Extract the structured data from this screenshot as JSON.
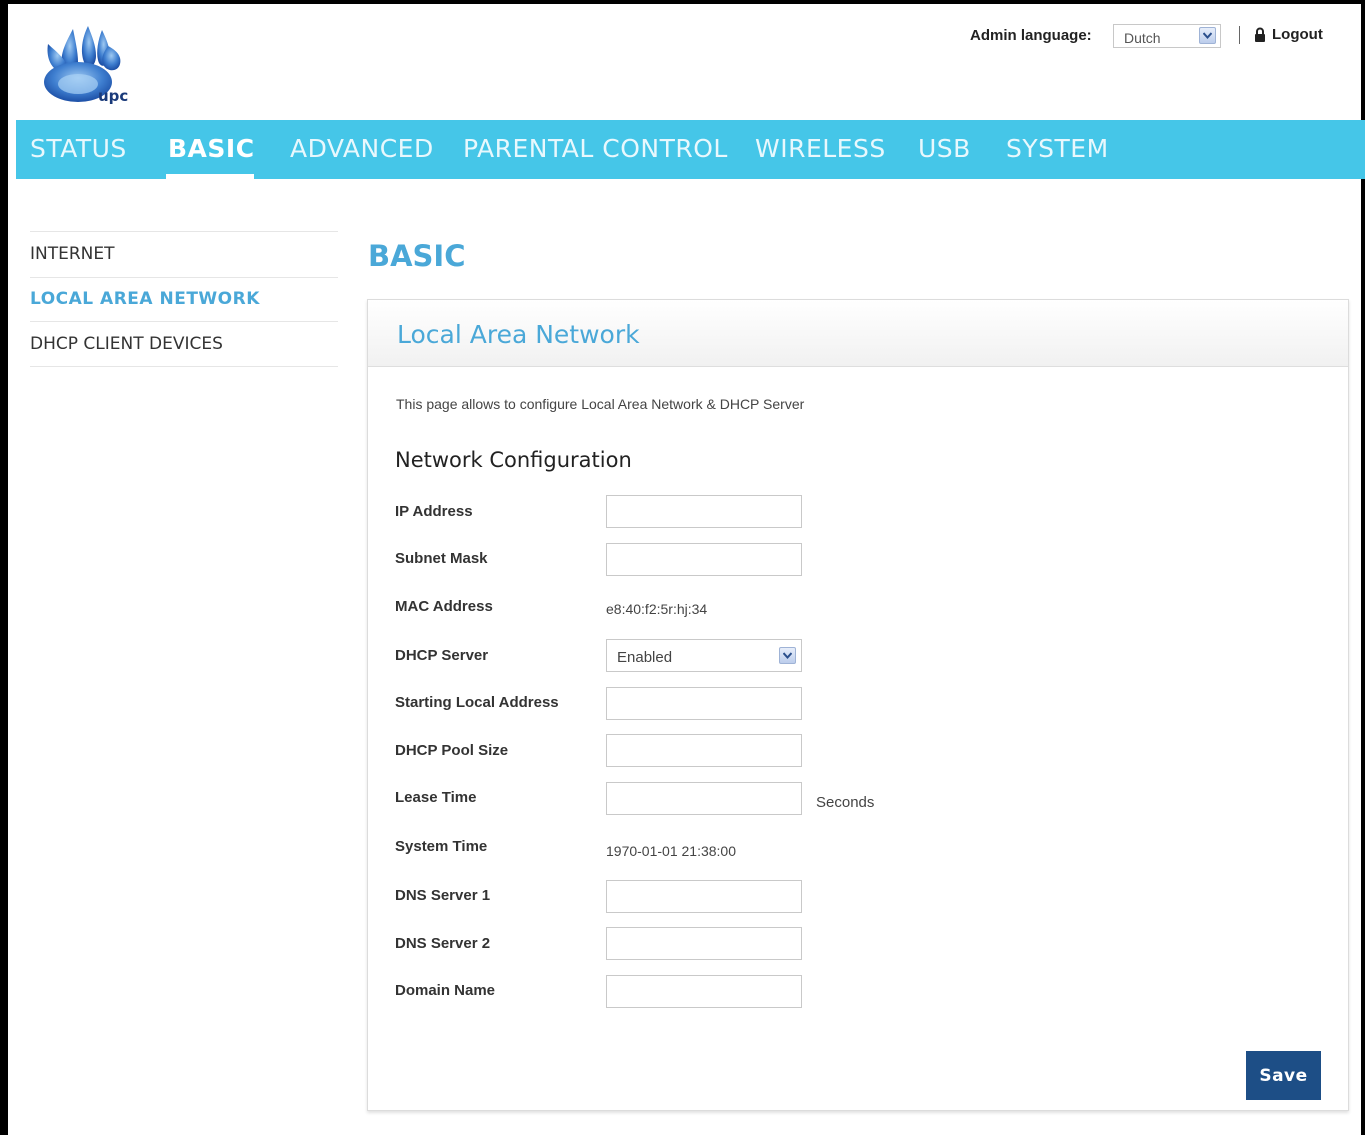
{
  "header": {
    "logo_text": "upc",
    "admin_language_label": "Admin language:",
    "admin_language_value": "Dutch",
    "logout_label": "Logout"
  },
  "nav": {
    "items": [
      "STATUS",
      "BASIC",
      "ADVANCED",
      "PARENTAL CONTROL",
      "WIRELESS",
      "USB",
      "SYSTEM"
    ],
    "active": "BASIC"
  },
  "sidebar": {
    "items": [
      "INTERNET",
      "LOCAL AREA NETWORK",
      "DHCP CLIENT DEVICES"
    ],
    "active": "LOCAL AREA NETWORK"
  },
  "main": {
    "page_title": "BASIC",
    "panel_title": "Local Area Network",
    "description": "This page allows to configure Local Area Network & DHCP Server",
    "section_title": "Network Configuration",
    "fields": {
      "ip_address": {
        "label": "IP Address",
        "value": ""
      },
      "subnet_mask": {
        "label": "Subnet Mask",
        "value": ""
      },
      "mac_address": {
        "label": "MAC Address",
        "value": "e8:40:f2:5r:hj:34"
      },
      "dhcp_server": {
        "label": "DHCP Server",
        "value": "Enabled"
      },
      "starting_local_address": {
        "label": "Starting Local Address",
        "value": ""
      },
      "dhcp_pool_size": {
        "label": "DHCP Pool Size",
        "value": ""
      },
      "lease_time": {
        "label": "Lease Time",
        "value": "",
        "unit": "Seconds"
      },
      "system_time": {
        "label": "System Time",
        "value": "1970-01-01 21:38:00"
      },
      "dns_server_1": {
        "label": "DNS Server 1",
        "value": ""
      },
      "dns_server_2": {
        "label": "DNS Server 2",
        "value": ""
      },
      "domain_name": {
        "label": "Domain Name",
        "value": ""
      }
    },
    "save_label": "Save"
  },
  "colors": {
    "nav_bg": "#45c6e8",
    "accent": "#4aa8d8",
    "save_bg": "#1d4e86"
  },
  "icons": [
    "upc-logo-icon",
    "chevron-down-icon",
    "lock-icon"
  ]
}
